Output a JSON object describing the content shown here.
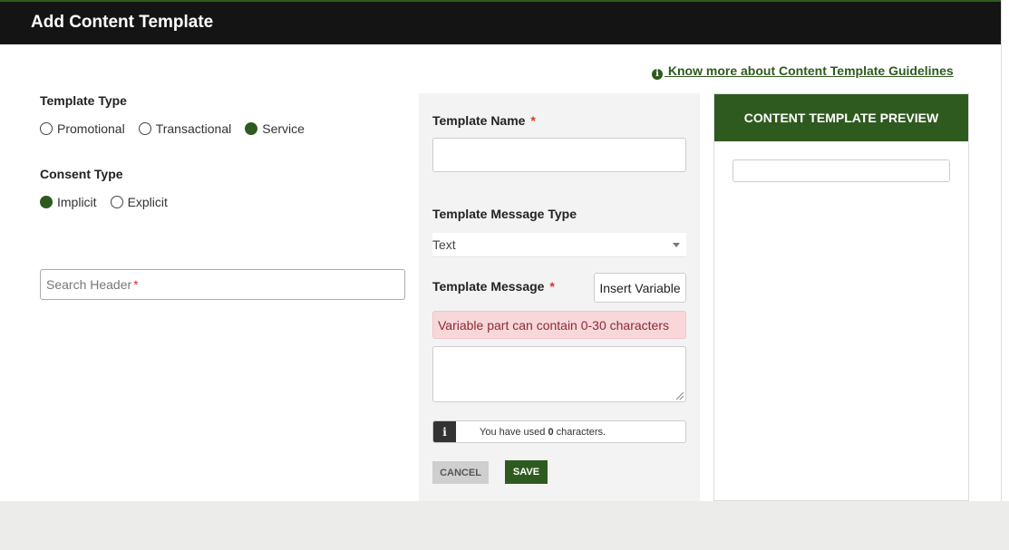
{
  "header": {
    "title": "Add Content Template"
  },
  "guidelines_link": "Know more about Content Template Guidelines",
  "template_type": {
    "label": "Template Type",
    "options": [
      "Promotional",
      "Transactional",
      "Service"
    ],
    "selected": "Service"
  },
  "consent_type": {
    "label": "Consent Type",
    "options": [
      "Implicit",
      "Explicit"
    ],
    "selected": "Implicit"
  },
  "search_header": {
    "placeholder": "Search Header",
    "required_mark": "*"
  },
  "form": {
    "template_name_label": "Template Name",
    "template_name_value": "",
    "message_type_label": "Template Message Type",
    "message_type_value": "Text",
    "message_label": "Template Message",
    "required_mark": "*",
    "insert_variable_label": "Insert Variable",
    "alert_text": "Variable part can contain 0-30 characters",
    "message_value": "",
    "counter_prefix": "You have used",
    "counter_count": "0",
    "counter_suffix": "characters.",
    "cancel_label": "CANCEL",
    "save_label": "SAVE"
  },
  "preview": {
    "title": "CONTENT TEMPLATE PREVIEW"
  },
  "colors": {
    "accent": "#2f5a1f",
    "titlebar": "#141414",
    "alert_bg": "#f8d7da"
  },
  "icons": {
    "info": "info-circle-icon",
    "counter": "info-icon",
    "select": "caret-down-icon"
  }
}
